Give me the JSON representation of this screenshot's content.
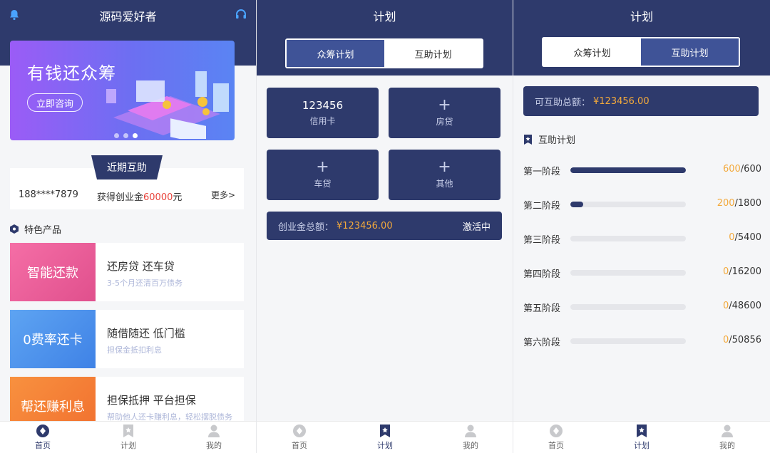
{
  "screen1": {
    "title": "源码爱好者",
    "banner": {
      "title": "有钱还众筹",
      "button": "立即咨询"
    },
    "recent": {
      "tab": "近期互助",
      "phone": "188****7879",
      "msg_prefix": "获得创业金",
      "amount": "60000",
      "msg_suffix": "元",
      "more": "更多>"
    },
    "featured_title": "特色产品",
    "products": [
      {
        "block": "智能还款",
        "main": "还房贷 还车贷",
        "sub": "3-5个月还清百万债务",
        "color": "#ee5a9b"
      },
      {
        "block": "0费率还卡",
        "main": "随借随还 低门槛",
        "sub": "担保金抵扣利息",
        "color": "#4f94ec"
      },
      {
        "block": "帮还赚利息",
        "main": "担保抵押 平台担保",
        "sub": "帮助他人还卡赚利息，轻松摆脱债务",
        "color": "#f57f3a"
      }
    ]
  },
  "screen2": {
    "title": "计划",
    "seg": [
      "众筹计划",
      "互助计划"
    ],
    "cards": [
      {
        "num": "123456",
        "label": "信用卡"
      },
      {
        "plus": "+",
        "label": "房贷"
      },
      {
        "plus": "+",
        "label": "车贷"
      },
      {
        "plus": "+",
        "label": "其他"
      }
    ],
    "total_label": "创业金总额：",
    "total_amount": "¥123456.00",
    "action": "激活中"
  },
  "screen3": {
    "title": "计划",
    "seg": [
      "众筹计划",
      "互助计划"
    ],
    "total_label": "可互助总额：",
    "total_amount": "¥123456.00",
    "plan_title": "互助计划",
    "stages": [
      {
        "name": "第一阶段",
        "done": "600",
        "sep": "/",
        "total": "600",
        "progress": 1.0
      },
      {
        "name": "第二阶段",
        "done": "200",
        "sep": "/",
        "total": "1800",
        "progress": 0.11
      },
      {
        "name": "第三阶段",
        "done": "0",
        "sep": "/",
        "total": "5400",
        "progress": 0
      },
      {
        "name": "第四阶段",
        "done": "0",
        "sep": "/",
        "total": "16200",
        "progress": 0
      },
      {
        "name": "第五阶段",
        "done": "0",
        "sep": "/",
        "total": "48600",
        "progress": 0
      },
      {
        "name": "第六阶段",
        "done": "0",
        "sep": "/",
        "total": "50856",
        "progress": 0
      }
    ]
  },
  "tabs": [
    "首页",
    "计划",
    "我的"
  ],
  "colors": {
    "primary": "#2e3a6c",
    "accent": "#f3a93b",
    "red": "#e8433b"
  }
}
